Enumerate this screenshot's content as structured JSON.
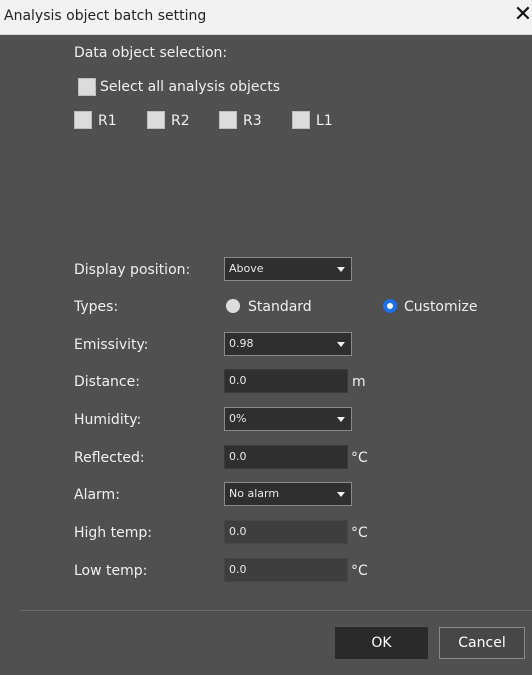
{
  "dialog": {
    "title": "Analysis object batch setting"
  },
  "selection": {
    "heading": "Data object selection:",
    "select_all_label": "Select all analysis objects",
    "objects": [
      "R1",
      "R2",
      "R3",
      "L1"
    ]
  },
  "settings": {
    "display_position_label": "Display position:",
    "display_position_value": "Above",
    "types_label": "Types:",
    "type_standard": "Standard",
    "type_customize": "Customize",
    "emissivity_label": "Emissivity:",
    "emissivity_value": "0.98",
    "distance_label": "Distance:",
    "distance_value": "0.0",
    "distance_unit": "m",
    "humidity_label": "Humidity:",
    "humidity_value": "0%",
    "reflected_label": "Reflected:",
    "reflected_value": "0.0",
    "reflected_unit": "°C",
    "alarm_label": "Alarm:",
    "alarm_value": "No alarm",
    "high_temp_label": "High temp:",
    "high_temp_value": "0.0",
    "high_temp_unit": "°C",
    "low_temp_label": "Low temp:",
    "low_temp_value": "0.0",
    "low_temp_unit": "°C"
  },
  "footer": {
    "ok_label": "OK",
    "cancel_label": "Cancel"
  },
  "colors": {
    "background": "#505050",
    "radio_selected": "#1f6fe5",
    "titlebar": "#f2f2f2"
  }
}
